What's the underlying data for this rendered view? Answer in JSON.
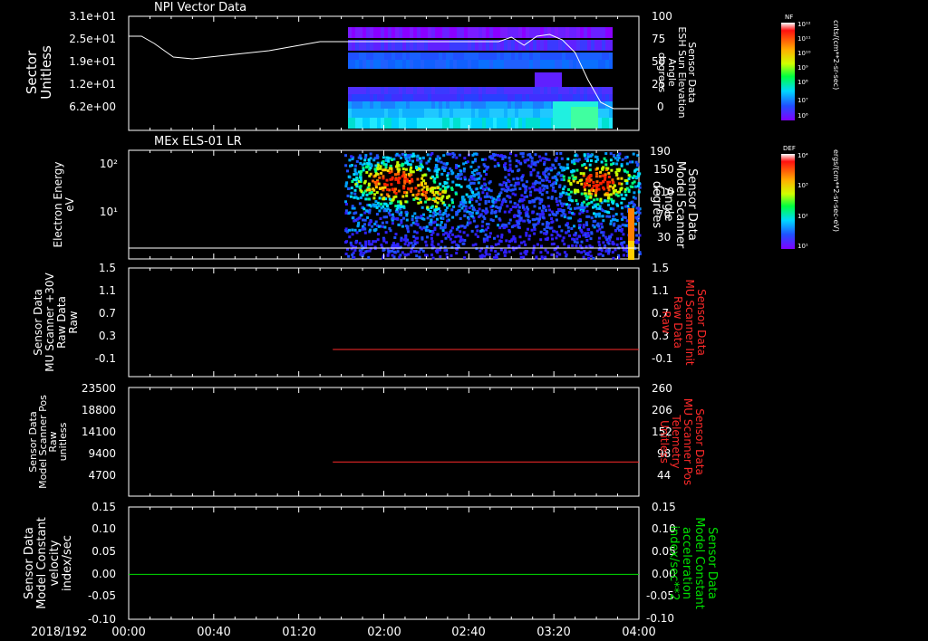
{
  "date_label": "2018/192",
  "x_ticks": [
    "00:00",
    "00:40",
    "01:20",
    "02:00",
    "02:40",
    "03:20",
    "04:00"
  ],
  "colors": {
    "white": "#ffffff",
    "red": "#ff2a2a",
    "green": "#00e000"
  },
  "chart_data": [
    {
      "type": "heatmap",
      "title": "NPI Vector Data",
      "ylabel_lines": [
        "Sector",
        "Unitless"
      ],
      "left_ticks": [
        "3.1e+01",
        "2.5e+01",
        "1.9e+01",
        "1.2e+01",
        "6.2e+00"
      ],
      "right_ticks": [
        "100",
        "75",
        "50",
        "25",
        "0"
      ],
      "right_label_lines": [
        "Sensor Data",
        "ESH Sun Elevation",
        "Angle",
        "degrees"
      ],
      "colorbar_tag": "NF",
      "colorbar_ticks": [
        "10¹²",
        "10¹¹",
        "10¹⁰",
        "10⁹",
        "10⁸",
        "10⁷",
        "10⁶"
      ],
      "colorbar_units": "cnts/(cm**2-sr-sec)",
      "line_series": {
        "name": "ESH Sun Elevation Angle",
        "x_hours": [
          0,
          0.1,
          0.2,
          0.35,
          0.5,
          0.7,
          0.9,
          1.1,
          1.3,
          1.5,
          1.7,
          1.9,
          2.1,
          2.3,
          2.6,
          2.8,
          2.9,
          3.0,
          3.1,
          3.2,
          3.3,
          3.4,
          3.5,
          3.6,
          3.7,
          3.8,
          3.9,
          4.0
        ],
        "y_degrees": [
          78,
          78,
          70,
          55,
          53,
          56,
          59,
          62,
          67,
          72,
          72,
          72,
          72,
          72,
          72,
          72,
          72,
          77,
          68,
          78,
          80,
          74,
          60,
          30,
          5,
          -2,
          -2,
          -2
        ]
      }
    },
    {
      "type": "heatmap",
      "title": "MEx ELS-01 LR",
      "ylabel_lines": [
        "Electron Energy",
        "eV"
      ],
      "left_ticks": [
        "10²",
        "10¹"
      ],
      "right_ticks": [
        "190",
        "150",
        "110",
        "70",
        "30"
      ],
      "right_label_lines": [
        "Sensor Data",
        "Model Scanner",
        "Angle",
        "degrees"
      ],
      "colorbar_tag": "DEF",
      "colorbar_ticks": [
        "10⁴",
        "10³",
        "10²",
        "10¹"
      ],
      "colorbar_units": "ergs/(cm**2-sr-sec-eV)"
    },
    {
      "type": "line",
      "ylabel_lines": [
        "Sensor Data",
        "MU Scanner +30V",
        "Raw Data",
        "Raw"
      ],
      "left_ticks": [
        "1.5",
        "1.1",
        "0.7",
        "0.3",
        "-0.1"
      ],
      "right_ticks": [
        "1.5",
        "1.1",
        "0.7",
        "0.3",
        "-0.1"
      ],
      "right_label_lines": [
        "Sensor Data",
        "MU Scanner Init",
        "Raw Data",
        "Raw"
      ],
      "ylim": [
        -0.3,
        1.5
      ],
      "series": [
        {
          "name": "MU Scanner Init Raw Data",
          "x_hours": [
            1.6,
            4.0
          ],
          "y": [
            -0.2,
            -0.2
          ]
        }
      ]
    },
    {
      "type": "line",
      "ylabel_lines": [
        "Sensor Data",
        "Model Scanner Pos",
        "Raw",
        "unitless"
      ],
      "left_ticks": [
        "23500",
        "18800",
        "14100",
        "9400",
        "4700"
      ],
      "right_ticks": [
        "260",
        "206",
        "152",
        "98",
        "44"
      ],
      "right_label_lines": [
        "Sensor Data",
        "MU Scanner Pos",
        "Telemetry",
        "Unitless"
      ],
      "ylim": [
        0,
        23500
      ],
      "series": [
        {
          "name": "MU Scanner Pos Telemetry",
          "x_hours": [
            1.6,
            4.0
          ],
          "y": [
            86,
            86
          ]
        }
      ]
    },
    {
      "type": "line",
      "ylabel_lines": [
        "Sensor Data",
        "Model Constant",
        "velocity",
        "index/sec"
      ],
      "left_ticks": [
        "0.15",
        "0.10",
        "0.05",
        "0.00",
        "-0.05",
        "-0.10"
      ],
      "right_ticks": [
        "0.15",
        "0.10",
        "0.05",
        "0.00",
        "-0.05",
        "-0.10"
      ],
      "right_label_lines": [
        "Sensor Data",
        "Model Constant",
        "acceleration",
        "index/sec**2"
      ],
      "ylim": [
        -0.1,
        0.15
      ],
      "series": [
        {
          "name": "Model Constant velocity",
          "x_hours": [
            0,
            4.0
          ],
          "y": [
            0,
            0
          ]
        }
      ]
    }
  ]
}
